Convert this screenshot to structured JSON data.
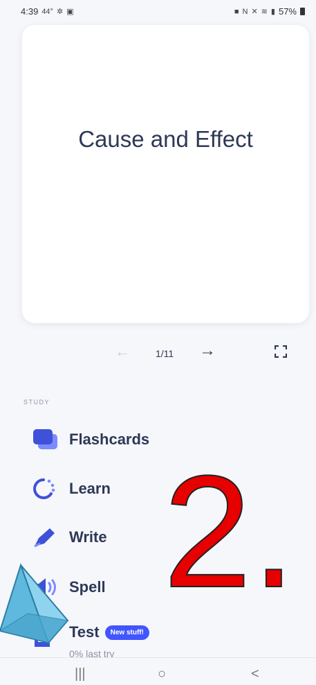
{
  "status_bar": {
    "time": "4:39",
    "extra_left": "44°",
    "battery_percent": "57%"
  },
  "flashcard": {
    "term": "Cause and Effect"
  },
  "navigation": {
    "counter": "1/11",
    "prev_icon": "arrow-left-icon",
    "next_icon": "arrow-right-icon",
    "fullscreen_icon": "fullscreen-icon"
  },
  "study": {
    "section_label": "STUDY",
    "items": [
      {
        "label": "Flashcards",
        "icon": "cards-icon"
      },
      {
        "label": "Learn",
        "icon": "learn-cycle-icon"
      },
      {
        "label": "Write",
        "icon": "pen-icon"
      },
      {
        "label": "Spell",
        "icon": "speaker-icon"
      },
      {
        "label": "Test",
        "icon": "test-document-icon",
        "badge": "New stuff!",
        "sub": "0% last try"
      }
    ]
  },
  "overlay": {
    "number": "2."
  },
  "system_nav": {
    "recents": "|||",
    "home": "○",
    "back": "<"
  },
  "colors": {
    "accent": "#4255ff",
    "text": "#2e3856",
    "overlay_red": "#e60000"
  }
}
